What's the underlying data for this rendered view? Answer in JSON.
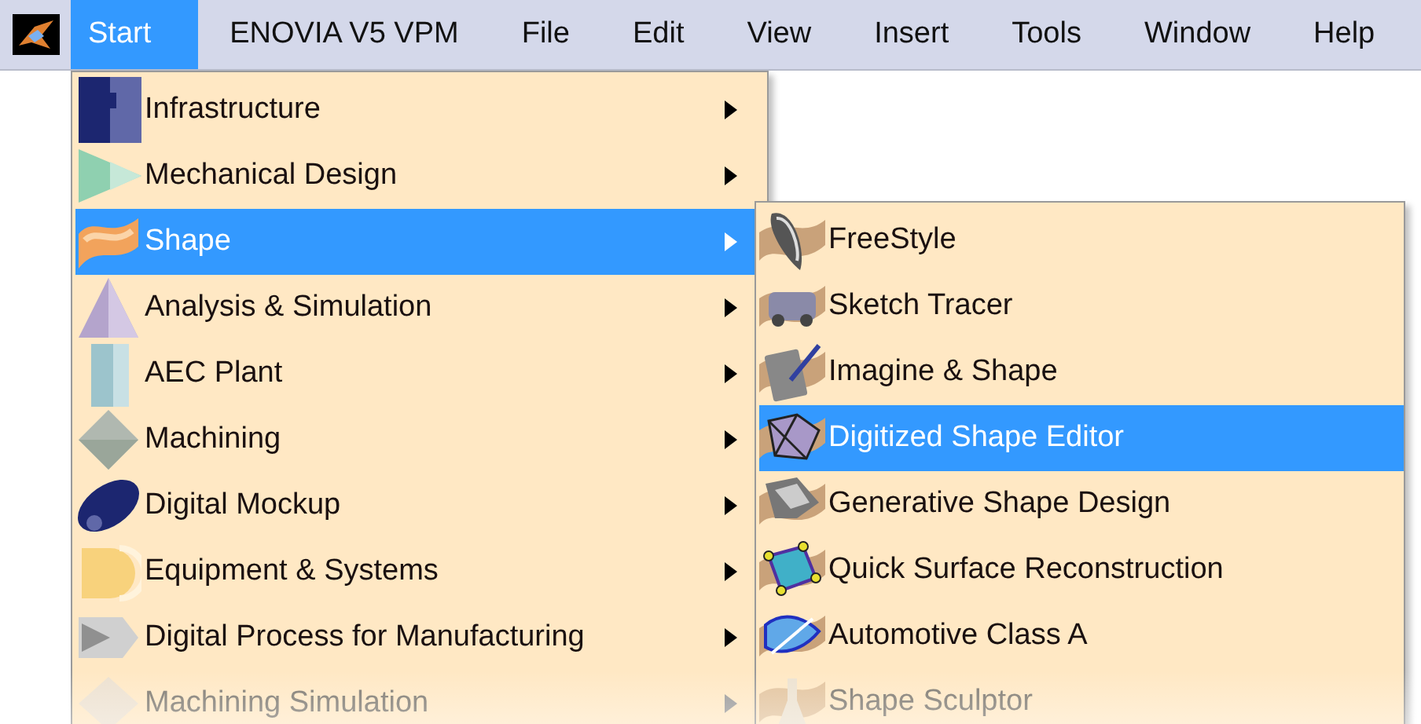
{
  "menu_bar": [
    {
      "label": "Start",
      "selected": true
    },
    {
      "label": "ENOVIA V5 VPM",
      "selected": false
    },
    {
      "label": "File",
      "selected": false
    },
    {
      "label": "Edit",
      "selected": false
    },
    {
      "label": "View",
      "selected": false
    },
    {
      "label": "Insert",
      "selected": false
    },
    {
      "label": "Tools",
      "selected": false
    },
    {
      "label": "Window",
      "selected": false
    },
    {
      "label": "Help",
      "selected": false
    }
  ],
  "start_menu": [
    {
      "label": "Infrastructure",
      "selected": false,
      "disabled": false
    },
    {
      "label": "Mechanical Design",
      "selected": false,
      "disabled": false
    },
    {
      "label": "Shape",
      "selected": true,
      "disabled": false
    },
    {
      "label": "Analysis & Simulation",
      "selected": false,
      "disabled": false
    },
    {
      "label": "AEC Plant",
      "selected": false,
      "disabled": false
    },
    {
      "label": "Machining",
      "selected": false,
      "disabled": false
    },
    {
      "label": "Digital Mockup",
      "selected": false,
      "disabled": false
    },
    {
      "label": "Equipment & Systems",
      "selected": false,
      "disabled": false
    },
    {
      "label": "Digital Process for Manufacturing",
      "selected": false,
      "disabled": false
    },
    {
      "label": "Machining Simulation",
      "selected": false,
      "disabled": true
    }
  ],
  "shape_submenu": [
    {
      "label": "FreeStyle",
      "selected": false,
      "disabled": false
    },
    {
      "label": "Sketch Tracer",
      "selected": false,
      "disabled": false
    },
    {
      "label": "Imagine & Shape",
      "selected": false,
      "disabled": false
    },
    {
      "label": "Digitized Shape Editor",
      "selected": true,
      "disabled": false
    },
    {
      "label": "Generative Shape Design",
      "selected": false,
      "disabled": false
    },
    {
      "label": "Quick Surface Reconstruction",
      "selected": false,
      "disabled": false
    },
    {
      "label": "Automotive Class A",
      "selected": false,
      "disabled": false
    },
    {
      "label": "Shape Sculptor",
      "selected": false,
      "disabled": true
    }
  ]
}
